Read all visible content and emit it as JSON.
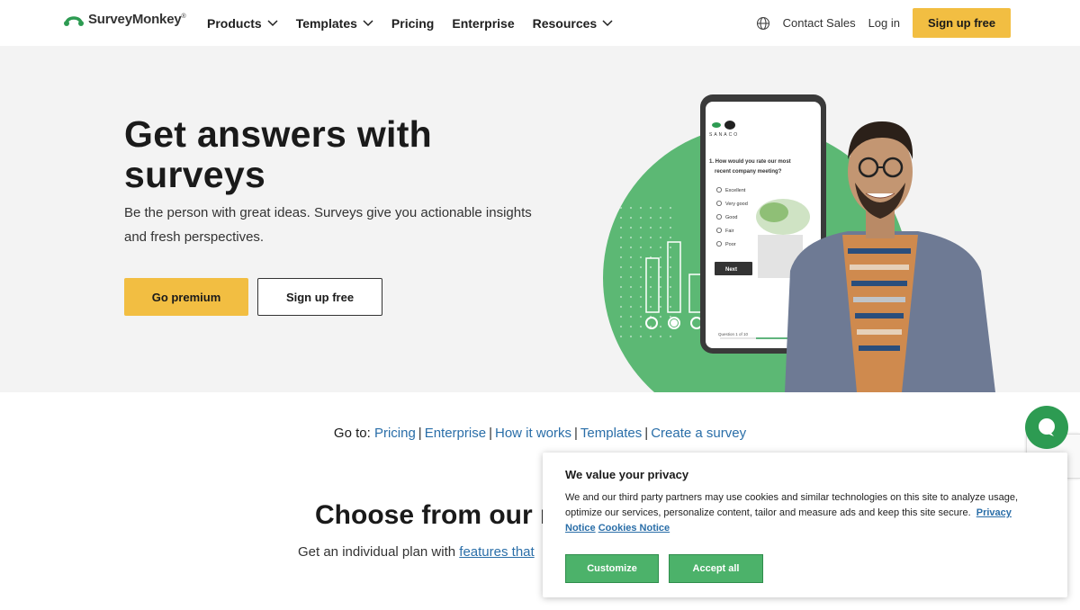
{
  "brand": {
    "name": "SurveyMonkey",
    "mark": "®",
    "accent": "#f2be42",
    "green": "#4cb26a"
  },
  "nav": {
    "items": [
      {
        "label": "Products",
        "dropdown": true
      },
      {
        "label": "Templates",
        "dropdown": true
      },
      {
        "label": "Pricing",
        "dropdown": false
      },
      {
        "label": "Enterprise",
        "dropdown": false
      },
      {
        "label": "Resources",
        "dropdown": true
      }
    ],
    "contact_sales": "Contact Sales",
    "login": "Log in",
    "signup": "Sign up free"
  },
  "hero": {
    "title": "Get answers with surveys",
    "subtitle": "Be the person with great ideas. Surveys give you actionable insights and fresh perspectives.",
    "primary_cta": "Go premium",
    "secondary_cta": "Sign up free",
    "phone": {
      "brand": "SANACO",
      "question": "1. How would you rate our most recent company meeting?",
      "options": [
        "Excellent",
        "Very good",
        "Good",
        "Fair",
        "Poor"
      ],
      "next": "Next",
      "progress": "Question 1 of 10"
    }
  },
  "goto": {
    "prefix": "Go to:",
    "links": [
      "Pricing",
      "Enterprise",
      "How it works",
      "Templates",
      "Create a survey"
    ]
  },
  "plans": {
    "title": "Choose from our m",
    "subtitle_prefix": "Get an individual plan with ",
    "subtitle_link": "features that"
  },
  "cookie": {
    "title": "We value your privacy",
    "body": "We and our third party partners may use cookies and similar technologies on this site to analyze usage, optimize our services, personalize content, tailor and measure ads and keep this site secure.",
    "privacy_link": "Privacy Notice",
    "cookies_link": "Cookies Notice",
    "customize": "Customize",
    "accept": "Accept all"
  },
  "icons": {
    "logo": "surveymonkey-logo-icon",
    "globe": "globe-icon",
    "chevron": "chevron-down-icon",
    "chat": "chat-bubble-icon"
  }
}
